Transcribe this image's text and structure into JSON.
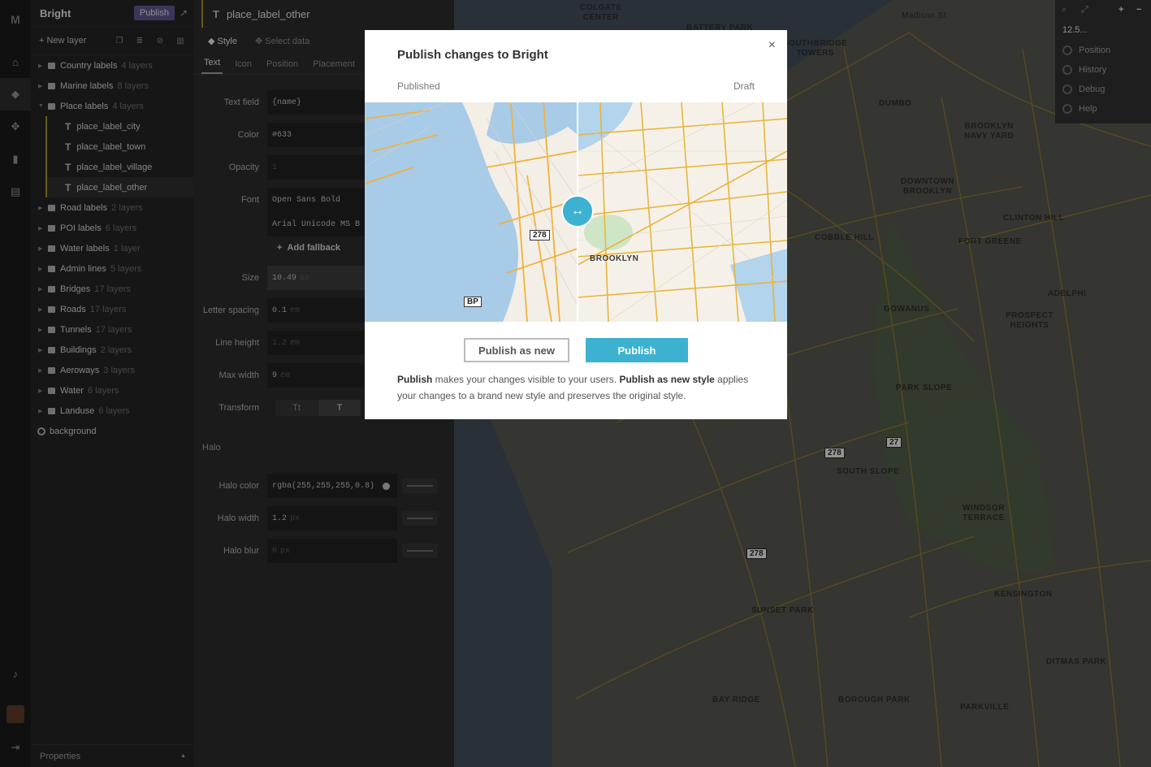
{
  "rail": {
    "logo": "M",
    "icons": [
      "home-icon",
      "paint-bucket-icon",
      "data-icon",
      "stats-icon",
      "files-icon",
      "bell-icon",
      "avatar",
      "logout-icon"
    ]
  },
  "layers_panel": {
    "style_name": "Bright",
    "publish_label": "Publish",
    "new_layer_label": "New layer",
    "groups": [
      {
        "name": "Country labels",
        "count": "4 layers"
      },
      {
        "name": "Marine labels",
        "count": "8 layers"
      },
      {
        "name": "Place labels",
        "count": "4 layers"
      },
      {
        "name": "Road labels",
        "count": "2 layers"
      },
      {
        "name": "POI labels",
        "count": "6 layers"
      },
      {
        "name": "Water labels",
        "count": "1 layer"
      },
      {
        "name": "Admin lines",
        "count": "5 layers"
      },
      {
        "name": "Bridges",
        "count": "17 layers"
      },
      {
        "name": "Roads",
        "count": "17 layers"
      },
      {
        "name": "Tunnels",
        "count": "17 layers"
      },
      {
        "name": "Buildings",
        "count": "2 layers"
      },
      {
        "name": "Aeroways",
        "count": "3 layers"
      },
      {
        "name": "Water",
        "count": "6 layers"
      },
      {
        "name": "Landuse",
        "count": "6 layers"
      }
    ],
    "place_layers": [
      "place_label_city",
      "place_label_town",
      "place_label_village",
      "place_label_other"
    ],
    "background_label": "background",
    "properties_label": "Properties"
  },
  "editor": {
    "layer_title": "place_label_other",
    "tabs": [
      "Style",
      "Select data"
    ],
    "sub_tabs": [
      "Text",
      "Icon",
      "Position",
      "Placement"
    ],
    "fields": {
      "text_field": {
        "label": "Text field",
        "value": "{name}"
      },
      "color": {
        "label": "Color",
        "value": "#633"
      },
      "opacity": {
        "label": "Opacity",
        "value": "1"
      },
      "font": {
        "label": "Font",
        "value": "Open Sans Bold",
        "value2": "Arial Unicode MS B"
      },
      "add_fallback": "Add fallback",
      "size": {
        "label": "Size",
        "value": "10.49",
        "unit": "px"
      },
      "letter_spacing": {
        "label": "Letter spacing",
        "value": "0.1",
        "unit": "em"
      },
      "line_height": {
        "label": "Line height",
        "value": "1.2",
        "unit": "em"
      },
      "max_width": {
        "label": "Max width",
        "value": "9",
        "unit": "em"
      },
      "transform": {
        "label": "Transform",
        "opt1": "Tt",
        "opt2": "T"
      }
    },
    "halo": {
      "heading": "Halo",
      "color": {
        "label": "Halo color",
        "value": "rgba(255,255,255,0.8)"
      },
      "width": {
        "label": "Halo width",
        "value": "1.2",
        "unit": "px"
      },
      "blur": {
        "label": "Halo blur",
        "value": "0",
        "unit": "px"
      }
    }
  },
  "map": {
    "zoom": "12.5...",
    "controls": [
      "Position",
      "History",
      "Debug",
      "Help"
    ],
    "labels": {
      "colgate": "COLGATE\nCENTER",
      "battery": "BATTERY PARK",
      "southbridge": "SOUTHBRIDGE\nTOWERS",
      "dumbo": "DUMBO",
      "navy_yard": "BROOKLYN\nNAVY YARD",
      "downtown": "DOWNTOWN\nBROOKLYN",
      "clinton": "CLINTON HILL",
      "cobble": "COBBLE HILL",
      "fort_greene": "FORT GREENE",
      "adelphi": "ADELPHI",
      "gowanus": "GOWANUS",
      "prospect": "PROSPECT\nHEIGHTS",
      "park_slope": "PARK SLOPE",
      "south_slope": "SOUTH SLOPE",
      "windsor": "WINDSOR\nTERRACE",
      "kensington": "KENSINGTON",
      "sunset": "SUNSET PARK",
      "ditmas": "DITMAS PARK",
      "bay_ridge": "BAY RIDGE",
      "borough_park": "BOROUGH PARK",
      "parkville": "PARKVILLE",
      "madison": "Madison St"
    },
    "shields": [
      "278",
      "27",
      "278"
    ]
  },
  "modal": {
    "title": "Publish changes to Bright",
    "close": "×",
    "published_label": "Published",
    "draft_label": "Draft",
    "preview_labels": {
      "brooklyn": "BROOKLYN",
      "shield_278": "278",
      "shield_bp": "BP"
    },
    "handle_glyph": "↔",
    "publish_as_new_label": "Publish as new",
    "publish_label": "Publish",
    "desc_b1": "Publish",
    "desc_t1": " makes your changes visible to your users. ",
    "desc_b2": "Publish as new style",
    "desc_t2": " applies your changes to a brand new style and preserves the original style."
  }
}
